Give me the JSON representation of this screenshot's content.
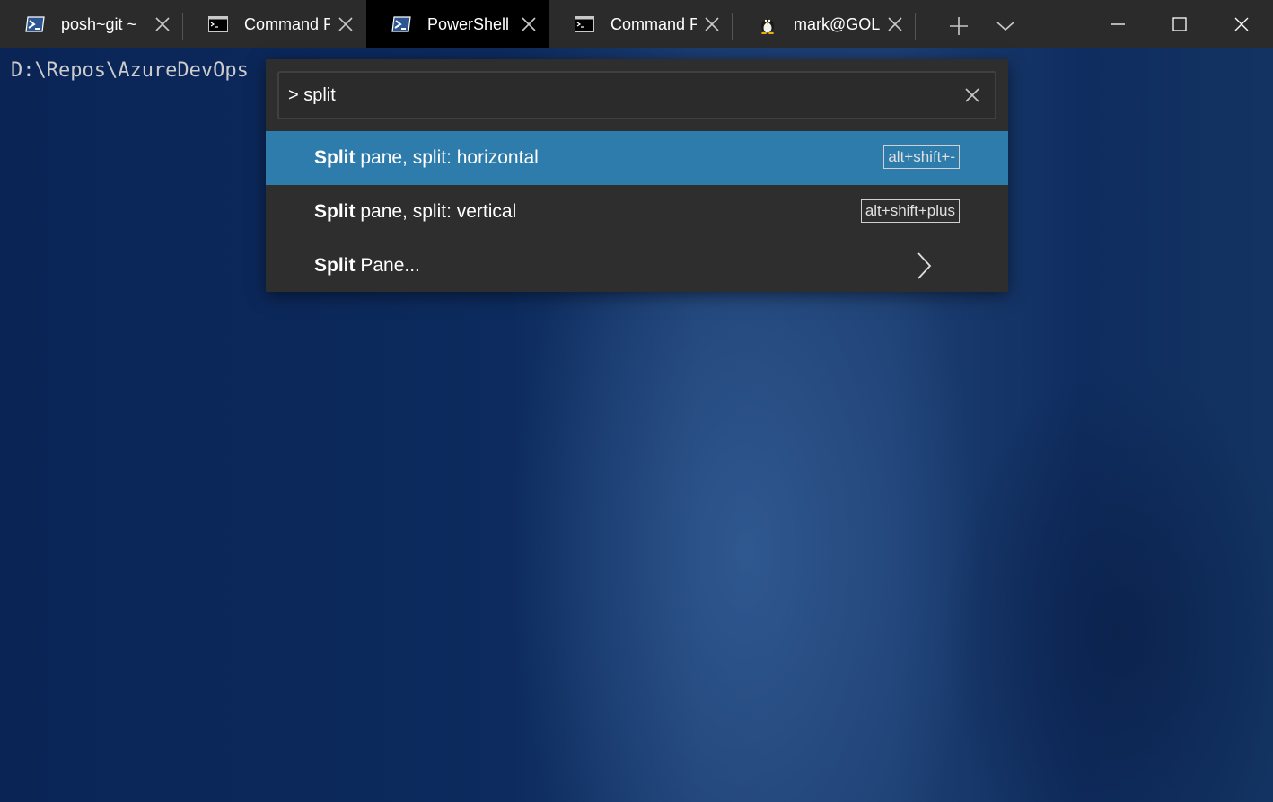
{
  "tabs": [
    {
      "title": "posh~git ~",
      "icon": "powershell-icon",
      "active": false
    },
    {
      "title": "Command Prompt",
      "icon": "cmd-icon",
      "active": false
    },
    {
      "title": "PowerShell",
      "icon": "powershell-icon",
      "active": true
    },
    {
      "title": "Command Prompt",
      "icon": "cmd-icon",
      "active": false
    },
    {
      "title": "mark@GOLIATH",
      "icon": "linux-penguin-icon",
      "active": false
    }
  ],
  "terminal": {
    "prompt": "D:\\Repos\\AzureDevOps"
  },
  "palette": {
    "search_value": "> split",
    "results": [
      {
        "match": "Split",
        "rest": " pane, split: horizontal",
        "keychord": "alt+shift+-",
        "selected": true
      },
      {
        "match": "Split",
        "rest": " pane, split: vertical",
        "keychord": "alt+shift+plus",
        "selected": false
      },
      {
        "match": "Split",
        "rest": " Pane...",
        "keychord": "",
        "selected": false,
        "has_submenu": true
      }
    ]
  },
  "colors": {
    "tabbar_bg": "#2b2b2b",
    "active_tab_bg": "#000000",
    "palette_bg": "#2e2e2e",
    "selected_row": "#2e7cab",
    "terminal_bg": "#0b2450"
  }
}
